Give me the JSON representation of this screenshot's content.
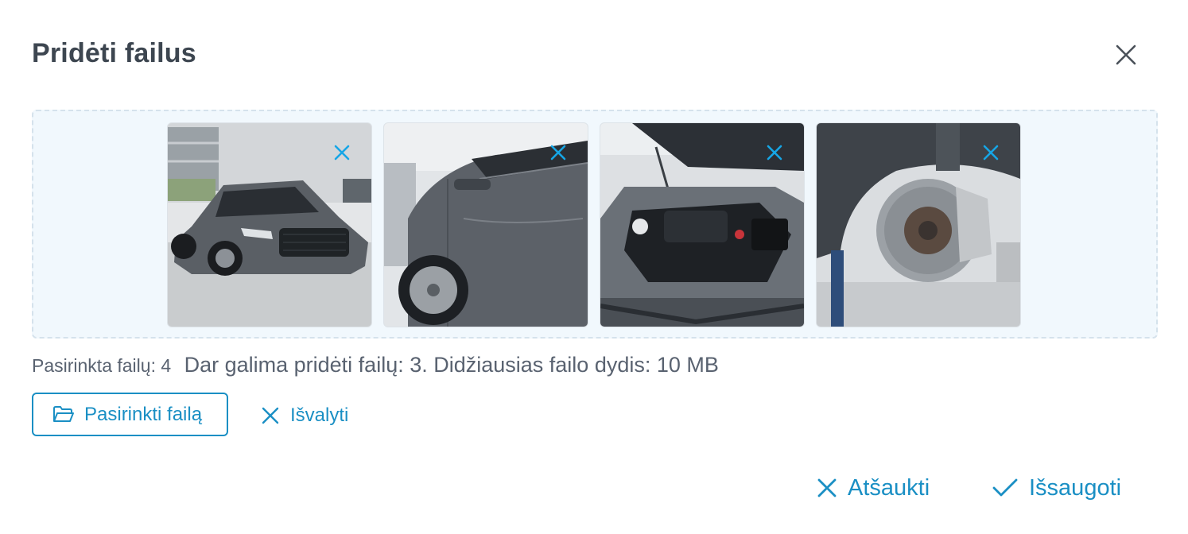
{
  "dialog": {
    "title": "Pridėti failus",
    "close_icon": "close-icon"
  },
  "dropzone": {
    "thumbnails": [
      {
        "subject": "car-front",
        "remove_icon": "close-icon"
      },
      {
        "subject": "car-side-door",
        "remove_icon": "close-icon"
      },
      {
        "subject": "car-engine-bay",
        "remove_icon": "close-icon"
      },
      {
        "subject": "brake-disc",
        "remove_icon": "close-icon"
      }
    ]
  },
  "info": {
    "selected_count": "Pasirinkta failų: 4",
    "limits": "Dar galima pridėti failų: 3. Didžiausias failo dydis: 10 MB"
  },
  "actions": {
    "pick_file": "Pasirinkti failą",
    "pick_icon": "folder-open-icon",
    "clear": "Išvalyti",
    "clear_icon": "close-icon"
  },
  "footer": {
    "cancel": "Atšaukti",
    "cancel_icon": "close-icon",
    "save": "Išsaugoti",
    "save_icon": "check-icon"
  },
  "colors": {
    "accent": "#1a8fc4",
    "thumb_remove": "#16a6e6",
    "dropzone_bg": "#f1f8fd",
    "dropzone_border": "#d5e2ec",
    "title": "#3d4650",
    "text": "#596270"
  }
}
